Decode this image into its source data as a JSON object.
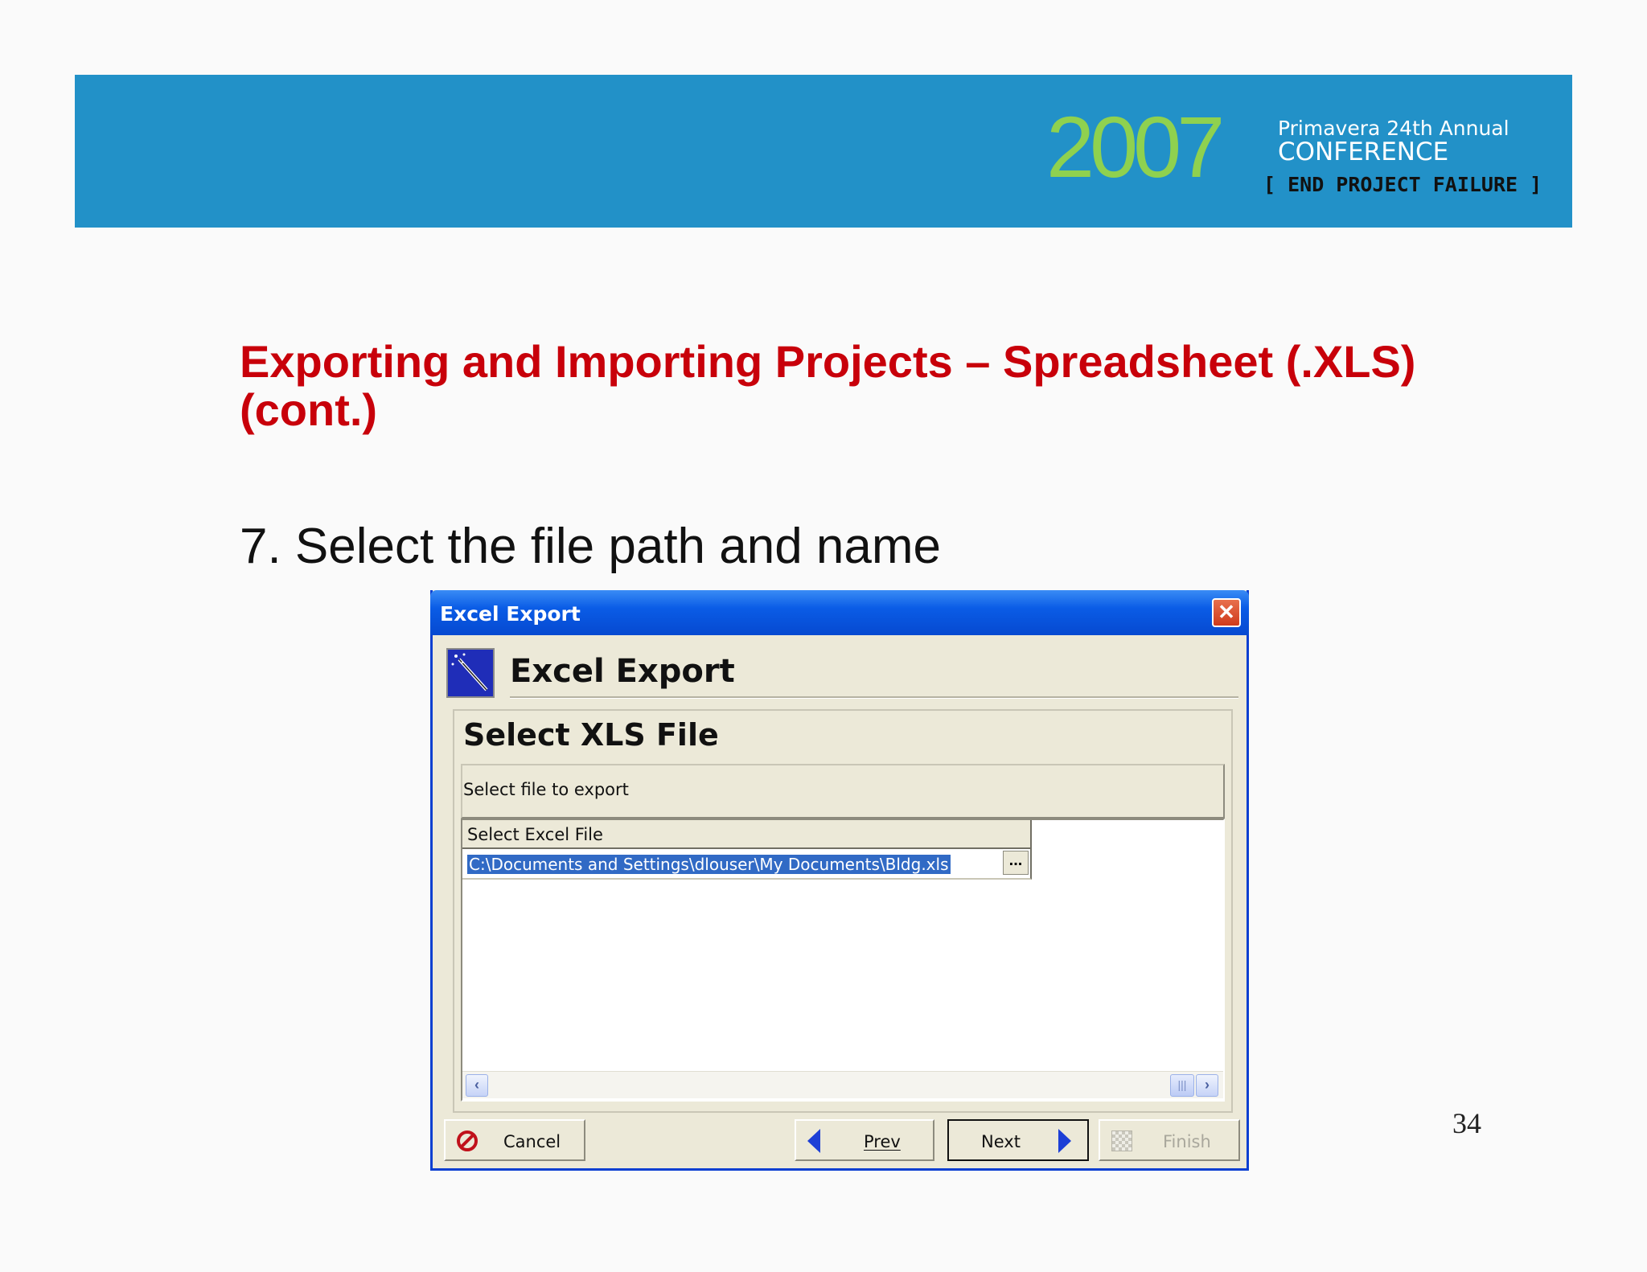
{
  "banner": {
    "year": "2007",
    "line1": "Primavera 24th Annual",
    "line2": "CONFERENCE",
    "line3": "[ END PROJECT FAILURE ]"
  },
  "slide": {
    "title": "Exporting and Importing Projects – Spreadsheet (.XLS) (cont.)",
    "step": "7. Select the file path and name",
    "page_number": "34"
  },
  "dialog": {
    "window_title": "Excel Export",
    "close_glyph": "✕",
    "header_title": "Excel Export",
    "panel_title": "Select XLS File",
    "description": "Select file to export",
    "column_header": "Select Excel File",
    "file_path": "C:\\Documents and Settings\\dlouser\\My Documents\\Bldg.xls",
    "browse_label": "...",
    "buttons": {
      "cancel": "Cancel",
      "prev": "Prev",
      "next": "Next",
      "finish": "Finish"
    }
  },
  "icons": [
    "wizard-wand-icon",
    "close-icon",
    "cancel-icon",
    "prev-arrow-icon",
    "next-arrow-icon",
    "finish-flag-icon",
    "scroll-left-icon",
    "scroll-right-icon"
  ],
  "colors": {
    "banner_bg": "#2291c8",
    "year_green": "#8fd14f",
    "title_red": "#c8000a",
    "titlebar_blue": "#0a5ce6",
    "selection_blue": "#316ac5"
  }
}
